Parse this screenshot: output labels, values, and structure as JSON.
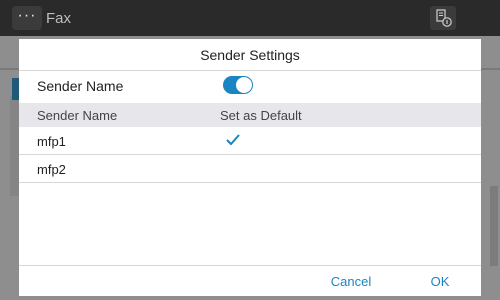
{
  "app": {
    "title": "Fax",
    "menu_icon": "ellipsis-icon",
    "history_icon": "history-info-icon"
  },
  "dialog": {
    "title": "Sender Settings",
    "sender_name_label": "Sender Name",
    "sender_name_enabled": true,
    "toggle_color": "#1b84c2",
    "columns": [
      "Sender Name",
      "Set as Default"
    ],
    "rows": [
      {
        "name": "mfp1",
        "default": true
      },
      {
        "name": "mfp2",
        "default": false
      }
    ],
    "buttons": {
      "cancel": "Cancel",
      "ok": "OK"
    }
  }
}
